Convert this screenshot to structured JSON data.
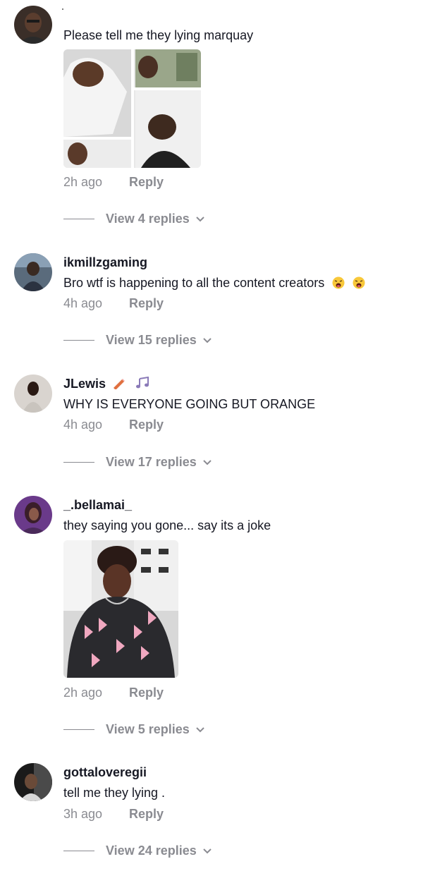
{
  "comments": [
    {
      "username": "",
      "text": "Please tell me they lying marquay",
      "time": "2h ago",
      "reply": "Reply",
      "view_replies": "View 4 replies",
      "has_image": true
    },
    {
      "username": "ikmillzgaming",
      "text": "Bro wtf is happening to all the content creators",
      "time": "4h ago",
      "reply": "Reply",
      "view_replies": "View 15 replies",
      "emojis": [
        "weary-face-emoji",
        "weary-face-emoji"
      ]
    },
    {
      "username": "JLewis",
      "text": "WHY IS EVERYONE GOING BUT ORANGE",
      "time": "4h ago",
      "reply": "Reply",
      "view_replies": "View 17 replies",
      "badges": [
        "pencil-icon",
        "music-notes-icon"
      ]
    },
    {
      "username": "_.bellamai_",
      "text": "they saying you gone... say its a joke",
      "time": "2h ago",
      "reply": "Reply",
      "view_replies": "View 5 replies",
      "has_image": true
    },
    {
      "username": "gottaloveregii",
      "text": "tell me they lying .",
      "time": "3h ago",
      "reply": "Reply",
      "view_replies": "View 24 replies"
    }
  ],
  "colors": {
    "text": "#161823",
    "muted": "#8a8b91",
    "background": "#ffffff"
  }
}
